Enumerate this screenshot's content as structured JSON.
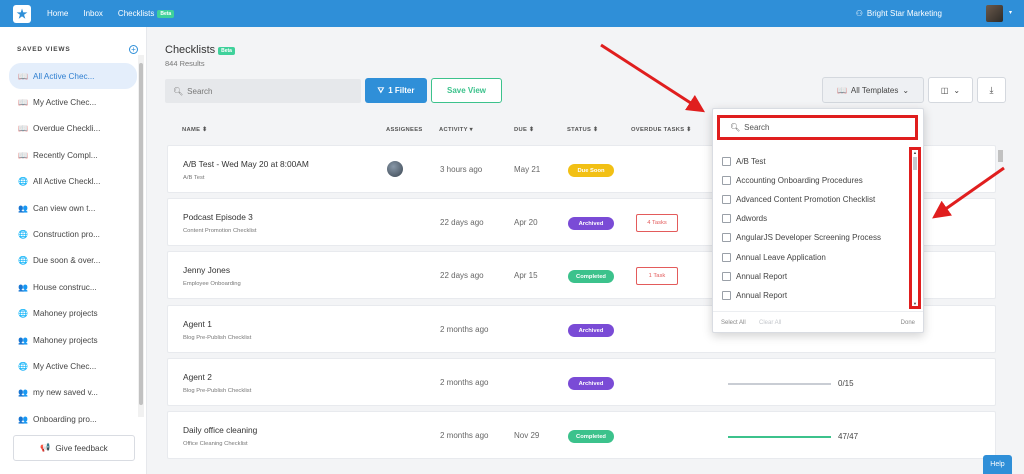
{
  "topbar": {
    "nav": [
      "Home",
      "Inbox",
      "Checklists"
    ],
    "beta_label": "Beta",
    "org_name": "Bright Star Marketing"
  },
  "sidebar": {
    "title": "SAVED VIEWS",
    "items": [
      {
        "label": "All Active Chec...",
        "icon": "book-icon",
        "glyph": "📖"
      },
      {
        "label": "My Active Chec...",
        "icon": "book-icon",
        "glyph": "📖"
      },
      {
        "label": "Overdue Checkli...",
        "icon": "book-icon",
        "glyph": "📖"
      },
      {
        "label": "Recently Compl...",
        "icon": "book-icon",
        "glyph": "📖"
      },
      {
        "label": "All Active Checkl...",
        "icon": "globe-icon",
        "glyph": "🌐"
      },
      {
        "label": "Can view own t...",
        "icon": "users-icon",
        "glyph": "👥"
      },
      {
        "label": "Construction pro...",
        "icon": "globe-icon",
        "glyph": "🌐"
      },
      {
        "label": "Due soon & over...",
        "icon": "globe-icon",
        "glyph": "🌐"
      },
      {
        "label": "House construc...",
        "icon": "users-icon",
        "glyph": "👥"
      },
      {
        "label": "Mahoney projects",
        "icon": "globe-icon",
        "glyph": "🌐"
      },
      {
        "label": "Mahoney projects",
        "icon": "users-icon",
        "glyph": "👥"
      },
      {
        "label": "My Active Chec...",
        "icon": "globe-icon",
        "glyph": "🌐"
      },
      {
        "label": "my new saved v...",
        "icon": "users-icon",
        "glyph": "👥"
      },
      {
        "label": "Onboarding pro...",
        "icon": "users-icon",
        "glyph": "👥"
      }
    ],
    "feedback_label": "Give feedback"
  },
  "main": {
    "title": "Checklists",
    "beta_label": "Beta",
    "count": "844 Results",
    "search_placeholder": "Search",
    "filter_label": "1 Filter",
    "save_view_label": "Save View",
    "templates_label": "All Templates",
    "columns": {
      "name": "NAME ⬍",
      "assignees": "ASSIGNEES",
      "activity": "ACTIVITY ▾",
      "due": "DUE ⬍",
      "status": "STATUS ⬍",
      "overdue": "OVERDUE TASKS ⬍"
    },
    "rows": [
      {
        "name": "A/B Test - Wed May 20 at 8:00AM",
        "template": "A/B Test",
        "activity": "3 hours ago",
        "due": "May 21",
        "status": "Due Soon",
        "status_type": "due",
        "overdue": "",
        "avatar": true,
        "progress": null,
        "progress_label": ""
      },
      {
        "name": "Podcast Episode 3",
        "template": "Content Promotion Checklist",
        "activity": "22 days ago",
        "due": "Apr 20",
        "status": "Archived",
        "status_type": "arch",
        "overdue": "4 Tasks",
        "avatar": false,
        "progress": null,
        "progress_label": ""
      },
      {
        "name": "Jenny Jones",
        "template": "Employee Onboarding",
        "activity": "22 days ago",
        "due": "Apr 15",
        "status": "Completed",
        "status_type": "comp",
        "overdue": "1 Task",
        "avatar": false,
        "progress": null,
        "progress_label": ""
      },
      {
        "name": "Agent 1",
        "template": "Blog Pre-Publish Checklist",
        "activity": "2 months ago",
        "due": "",
        "status": "Archived",
        "status_type": "arch",
        "overdue": "",
        "avatar": false,
        "progress": null,
        "progress_label": ""
      },
      {
        "name": "Agent 2",
        "template": "Blog Pre-Publish Checklist",
        "activity": "2 months ago",
        "due": "",
        "status": "Archived",
        "status_type": "arch",
        "overdue": "",
        "avatar": false,
        "progress": 0.0,
        "progress_label": "0/15"
      },
      {
        "name": "Daily office cleaning",
        "template": "Office Cleaning Checklist",
        "activity": "2 months ago",
        "due": "Nov 29",
        "status": "Completed",
        "status_type": "comp",
        "overdue": "",
        "avatar": false,
        "progress": 1.0,
        "progress_label": "47/47"
      }
    ]
  },
  "dropdown": {
    "search_placeholder": "Search",
    "options": [
      "A/B Test",
      "Accounting Onboarding Procedures",
      "Advanced Content Promotion Checklist",
      "Adwords",
      "AngularJS Developer Screening Process",
      "Annual Leave Application",
      "Annual Report",
      "Annual Report"
    ],
    "select_all": "Select All",
    "clear_all": "Clear All",
    "done": "Done"
  },
  "help_label": "Help",
  "colors": {
    "primary": "#2f8fd8",
    "success": "#3cc28c",
    "warning": "#f2c014",
    "archived": "#7a4bd6",
    "annotation": "#e01e1e"
  }
}
